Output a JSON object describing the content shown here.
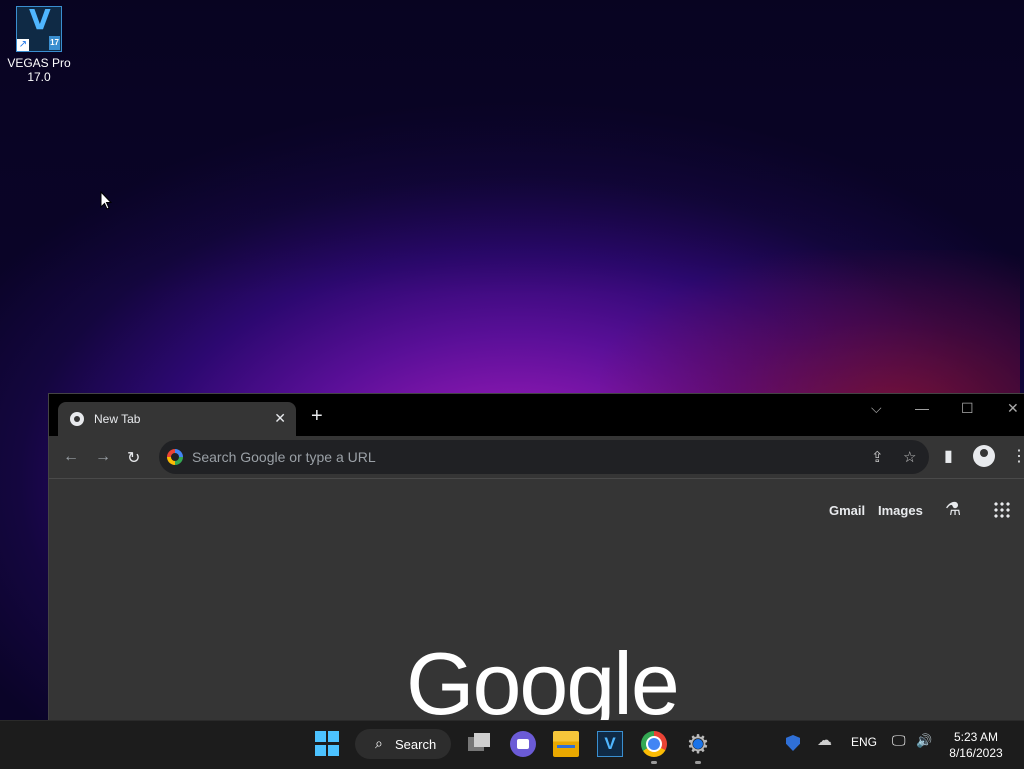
{
  "desktop": {
    "icons": [
      {
        "label_line1": "VEGAS Pro",
        "label_line2": "17.0",
        "glyph": "V",
        "badge": "17"
      }
    ]
  },
  "browser": {
    "tab": {
      "title": "New Tab",
      "close": "✕"
    },
    "new_tab": "+",
    "window_controls": {
      "dropdown": "⌵",
      "minimize": "—",
      "maximize": "☐",
      "close": "✕"
    },
    "nav": {
      "back": "←",
      "forward": "→",
      "reload": "↻"
    },
    "omnibox": {
      "placeholder": "Search Google or type a URL"
    },
    "toolbar_icons": {
      "share": "⇪",
      "bookmark": "☆",
      "side_panel": "▮",
      "menu": "⋮"
    },
    "content": {
      "gmail_link": "Gmail",
      "images_link": "Images",
      "labs_icon": "⚗",
      "logo": "Google"
    }
  },
  "taskbar": {
    "search_label": "Search",
    "search_glyph": "🔍",
    "vegas_glyph": "V",
    "settings_glyph": "⚙",
    "language": "ENG",
    "time": "5:23 AM",
    "date": "8/16/2023",
    "tray_cloud": "☁",
    "tray_network": "🖵",
    "tray_volume": "🔊"
  }
}
